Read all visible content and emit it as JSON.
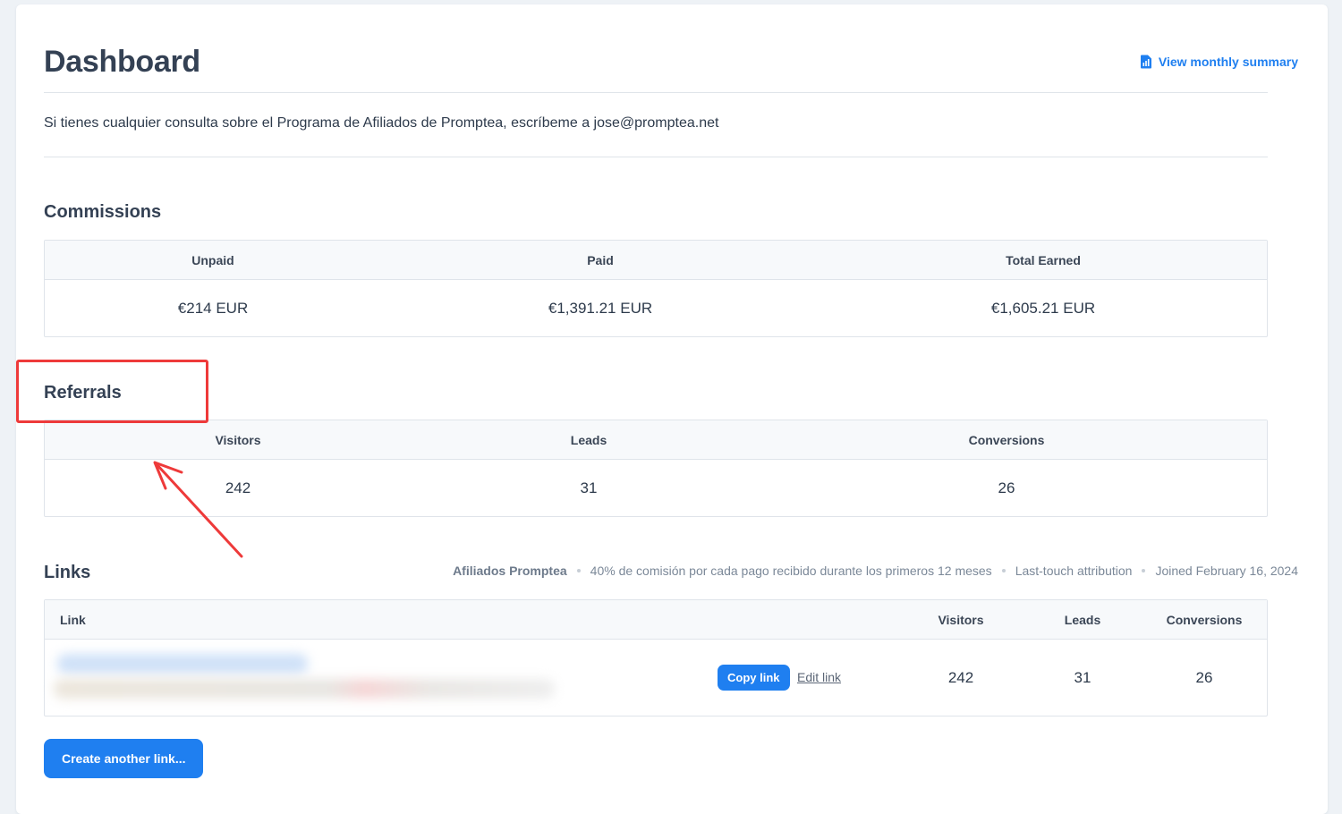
{
  "header": {
    "title": "Dashboard",
    "summary_link": "View monthly summary",
    "summary_icon": "chart-icon"
  },
  "intro": "Si tienes cualquier consulta sobre el Programa de Afiliados de Promptea, escríbeme a jose@promptea.net",
  "commissions": {
    "title": "Commissions",
    "columns": [
      "Unpaid",
      "Paid",
      "Total Earned"
    ],
    "values": [
      "€214 EUR",
      "€1,391.21 EUR",
      "€1,605.21 EUR"
    ]
  },
  "referrals": {
    "title": "Referrals",
    "columns": [
      "Visitors",
      "Leads",
      "Conversions"
    ],
    "values": [
      "242",
      "31",
      "26"
    ]
  },
  "links": {
    "title": "Links",
    "meta": {
      "program": "Afiliados Promptea",
      "commission": "40% de comisión por cada pago recibido durante los primeros 12 meses",
      "attribution": "Last-touch attribution",
      "joined": "Joined February 16, 2024"
    },
    "columns": [
      "Link",
      "Visitors",
      "Leads",
      "Conversions"
    ],
    "rows": [
      {
        "copy_label": "Copy link",
        "edit_label": "Edit link",
        "visitors": "242",
        "leads": "31",
        "conversions": "26"
      }
    ],
    "create_label": "Create another link..."
  },
  "colors": {
    "accent": "#1f7ff0",
    "annotation": "#ee3a3a",
    "background": "#eef2f6"
  }
}
